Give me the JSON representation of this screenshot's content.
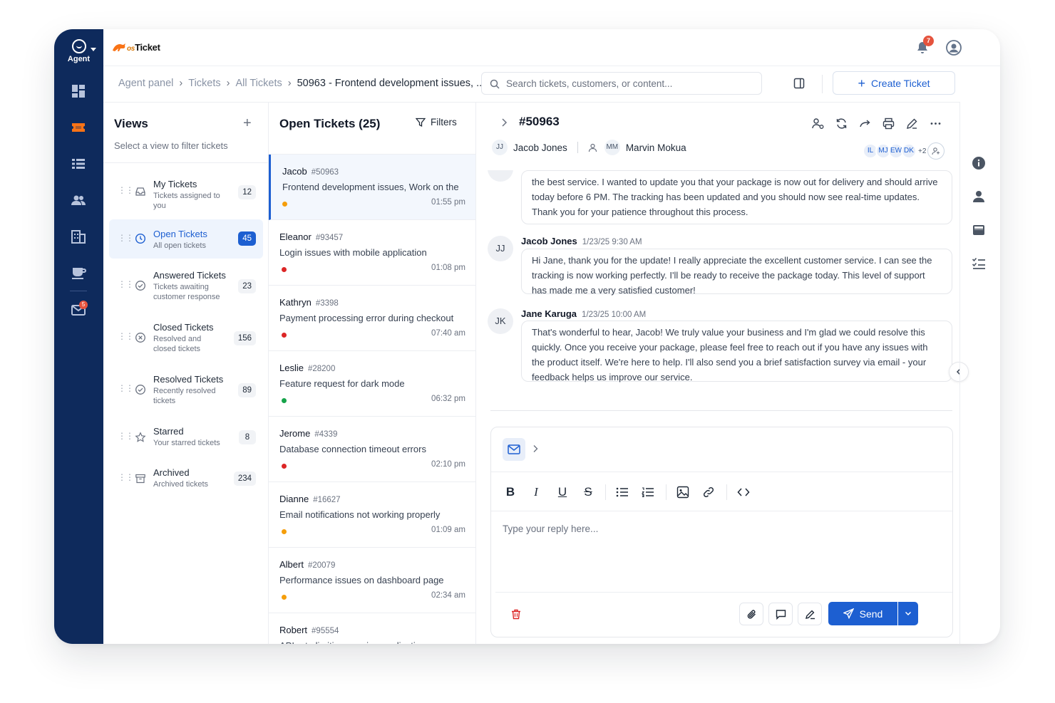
{
  "app": {
    "agent_label": "Agent",
    "logo": {
      "prefix": "os",
      "name": "Ticket"
    },
    "notification_count": "7",
    "mail_badge": "5"
  },
  "breadcrumb": [
    "Agent panel",
    "Tickets",
    "All Tickets",
    "50963 - Frontend development issues, ..."
  ],
  "search": {
    "placeholder": "Search tickets, customers, or content..."
  },
  "create_ticket_label": "Create Ticket",
  "views": {
    "title": "Views",
    "subtitle": "Select a view to filter tickets",
    "items": [
      {
        "label": "My Tickets",
        "desc": "Tickets assigned to you",
        "count": "12",
        "icon": "inbox-icon"
      },
      {
        "label": "Open Tickets",
        "desc": "All open tickets",
        "count": "45",
        "icon": "clock-icon"
      },
      {
        "label": "Answered Tickets",
        "desc": "Tickets awaiting customer response",
        "count": "23",
        "icon": "check-circle-icon"
      },
      {
        "label": "Closed Tickets",
        "desc": "Resolved and closed tickets",
        "count": "156",
        "icon": "x-circle-icon"
      },
      {
        "label": "Resolved Tickets",
        "desc": "Recently resolved tickets",
        "count": "89",
        "icon": "check-circle-icon"
      },
      {
        "label": "Starred",
        "desc": "Your starred tickets",
        "count": "8",
        "icon": "star-icon"
      },
      {
        "label": "Archived",
        "desc": "Archived tickets",
        "count": "234",
        "icon": "archive-icon"
      }
    ]
  },
  "ticket_list": {
    "title": "Open Tickets (25)",
    "filters_label": "Filters",
    "tickets": [
      {
        "name": "Jacob",
        "id": "#50963",
        "subject": "Frontend development issues, Work on the",
        "time": "01:55 pm",
        "priority_color": "#f59e0b"
      },
      {
        "name": "Eleanor",
        "id": "#93457",
        "subject": "Login issues with mobile application",
        "time": "01:08 pm",
        "priority_color": "#dc2626"
      },
      {
        "name": "Kathryn",
        "id": "#3398",
        "subject": "Payment processing error during checkout",
        "time": "07:40 am",
        "priority_color": "#dc2626"
      },
      {
        "name": "Leslie",
        "id": "#28200",
        "subject": "Feature request for dark mode",
        "time": "06:32 pm",
        "priority_color": "#16a34a"
      },
      {
        "name": "Jerome",
        "id": "#4339",
        "subject": "Database connection timeout errors",
        "time": "02:10 pm",
        "priority_color": "#dc2626"
      },
      {
        "name": "Dianne",
        "id": "#16627",
        "subject": "Email notifications not working properly",
        "time": "01:09 am",
        "priority_color": "#f59e0b"
      },
      {
        "name": "Albert",
        "id": "#20079",
        "subject": "Performance issues on dashboard page",
        "time": "02:34 am",
        "priority_color": "#f59e0b"
      },
      {
        "name": "Robert",
        "id": "#95554",
        "subject": "API rate limiting causing application errors",
        "time": "",
        "priority_color": "#dc2626"
      }
    ]
  },
  "detail": {
    "ticket_number": "#50963",
    "customer": {
      "initials": "JJ",
      "name": "Jacob Jones"
    },
    "assignee": {
      "initials": "MM",
      "name": "Marvin Mokua"
    },
    "watchers": [
      "IL",
      "MJ",
      "EW",
      "DK"
    ],
    "watchers_more": "+2",
    "messages": [
      {
        "text": "the best service. I wanted to update you that your package is now out for delivery and should arrive today before 6 PM. The tracking has been updated and you should now see real-time updates. Thank you for your patience throughout this process."
      },
      {
        "initials": "JJ",
        "author": "Jacob Jones",
        "time": "1/23/25 9:30 AM",
        "text": "Hi Jane, thank you for the update! I really appreciate the excellent customer service. I can see the tracking is now working perfectly. I'll be ready to receive the package today. This level of support has made me a very satisfied customer!"
      },
      {
        "initials": "JK",
        "author": "Jane Karuga",
        "time": "1/23/25 10:00 AM",
        "text": "That's wonderful to hear, Jacob! We truly value your business and I'm glad we could resolve this quickly. Once you receive your package, please feel free to reach out if you have any issues with the product itself. We're here to help. I'll also send you a brief satisfaction survey via email - your feedback helps us improve our service."
      }
    ]
  },
  "composer": {
    "placeholder": "Type your reply here...",
    "send_label": "Send"
  }
}
